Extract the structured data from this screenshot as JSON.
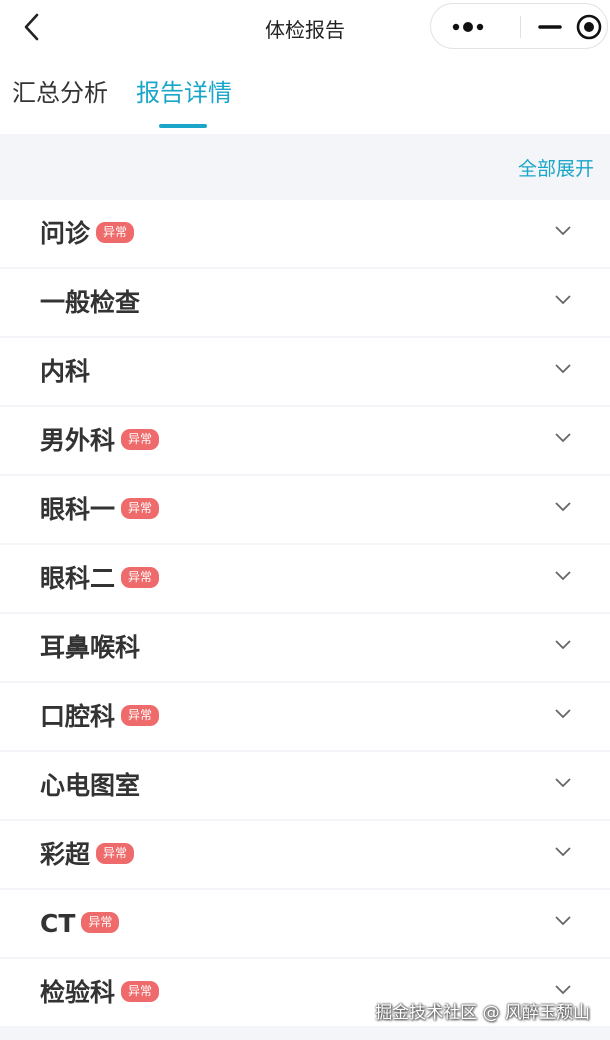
{
  "header": {
    "title": "体检报告",
    "back_icon": "chevron-left-icon",
    "capsule_icons": [
      "more-dots-icon",
      "minimize-icon",
      "close-target-icon"
    ]
  },
  "tabs": [
    {
      "label": "汇总分析",
      "active": false
    },
    {
      "label": "报告详情",
      "active": true
    }
  ],
  "toolbar": {
    "expand_all_label": "全部展开"
  },
  "sections": [
    {
      "label": "问诊",
      "badge": "异常"
    },
    {
      "label": "一般检查",
      "badge": ""
    },
    {
      "label": "内科",
      "badge": ""
    },
    {
      "label": "男外科",
      "badge": "异常"
    },
    {
      "label": "眼科一",
      "badge": "异常"
    },
    {
      "label": "眼科二",
      "badge": "异常"
    },
    {
      "label": "耳鼻喉科",
      "badge": ""
    },
    {
      "label": "口腔科",
      "badge": "异常"
    },
    {
      "label": "心电图室",
      "badge": ""
    },
    {
      "label": "彩超",
      "badge": "异常"
    },
    {
      "label": "CT",
      "badge": "异常"
    },
    {
      "label": "检验科",
      "badge": "异常"
    }
  ],
  "watermark": "掘金技术社区 @ 风醉玉颓山",
  "colors": {
    "accent": "#1aa6c9",
    "badge": "#ef6a6a",
    "background": "#f4f5f8"
  }
}
